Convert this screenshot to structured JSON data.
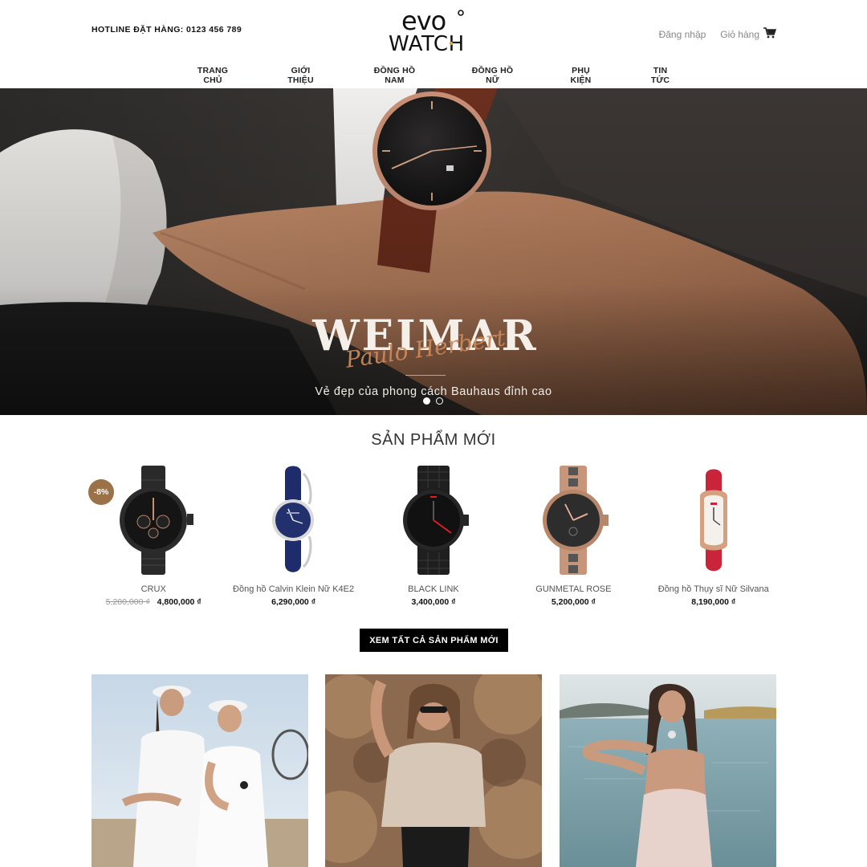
{
  "header": {
    "hotline": "HOTLINE ĐẶT HÀNG: 0123 456 789",
    "logo_top": "evo",
    "logo_bottom": "WATCH",
    "login": "Đăng nhập",
    "cart": "Giỏ hàng",
    "cart_icon": "cart-icon"
  },
  "nav": {
    "items": [
      "TRANG CHỦ",
      "GIỚI THIỆU",
      "ĐỒNG HỒ NAM",
      "ĐỒNG HỒ NỮ",
      "PHỤ KIỆN",
      "TIN TỨC"
    ]
  },
  "hero": {
    "brand": "WEIMAR",
    "script": "Paulo Herbert",
    "tagline": "Vẻ đẹp của phong cách Bauhaus đỉnh cao",
    "slides": 2,
    "active_slide": 1
  },
  "new_products": {
    "title": "SẢN PHẨM MỚI",
    "items": [
      {
        "name": "CRUX",
        "old_price": "5,200,000 ₫",
        "price": "4,800,000 ₫",
        "badge": "-8%"
      },
      {
        "name": "Đồng hồ Calvin Klein Nữ K4E2",
        "old_price": "",
        "price": "6,290,000 ₫",
        "badge": ""
      },
      {
        "name": "BLACK LINK",
        "old_price": "",
        "price": "3,400,000 ₫",
        "badge": ""
      },
      {
        "name": "GUNMETAL ROSE",
        "old_price": "",
        "price": "5,200,000 ₫",
        "badge": ""
      },
      {
        "name": "Đồng hồ Thụy sĩ Nữ Silvana",
        "old_price": "",
        "price": "8,190,000 ₫",
        "badge": ""
      }
    ],
    "view_all": "XEM TẤT CẢ SẢN PHẨM MỚI"
  },
  "colors": {
    "accent": "#9b7148",
    "button_bg": "#000000",
    "text": "#222222"
  }
}
